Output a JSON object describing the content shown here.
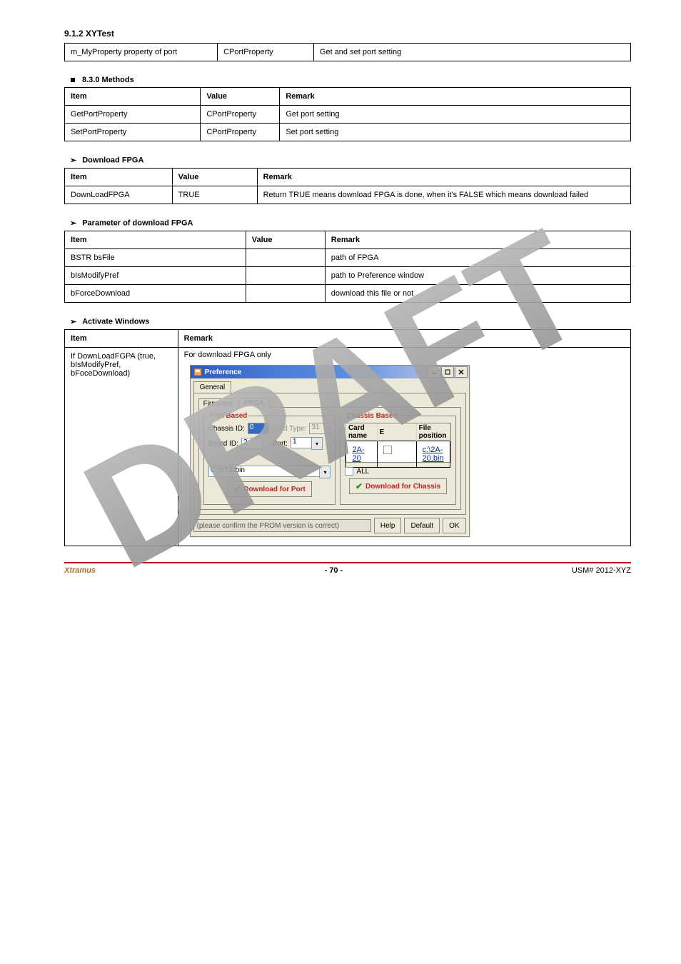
{
  "header1": {
    "title": "9.1.2  XYTest",
    "rows": [
      {
        "item": "m_MyProperty property of port",
        "value": "CPortProperty",
        "remark": "Get and set port setting"
      }
    ]
  },
  "sec830": {
    "title": "8.3.0  Methods",
    "rows": [
      {
        "item": "Item",
        "value": "Value",
        "remark": "Remark"
      },
      {
        "item": "GetPortProperty",
        "value": "CPortProperty",
        "remark": "Get port setting"
      },
      {
        "item": "SetPortProperty",
        "value": "CPortProperty",
        "remark": "Set port setting"
      }
    ]
  },
  "download": {
    "title": "Download FPGA",
    "rows": [
      {
        "item": "Item",
        "value": "Value",
        "remark": "Remark"
      },
      {
        "item": "DownLoadFPGA",
        "value": "TRUE",
        "remark": "Return TRUE means download FPGA is done, when it's FALSE which means download failed"
      }
    ]
  },
  "fpga": {
    "title": "Parameter of download FPGA",
    "rows": [
      {
        "item": "Item",
        "value": "Value",
        "remark": "Remark"
      },
      {
        "item": "BSTR bsFile",
        "value": "",
        "remark": "path of FPGA"
      },
      {
        "item": "bIsModifyPref",
        "value": "",
        "remark": "path to Preference window"
      },
      {
        "item": "bForceDownload",
        "value": "",
        "remark": "download this file or not"
      }
    ]
  },
  "activate": {
    "title": "Activate Windows",
    "rows": [
      {
        "item": "Item",
        "remark": "Remark"
      },
      {
        "item": "If DownLoadFGPA (true, bIsModifyPref, bFoceDownload)",
        "remark": "For download FPGA only"
      }
    ]
  },
  "pref": {
    "title": "Preference",
    "tab_general": "General",
    "tab_firmware": "Firmware",
    "tab_fpga": "FPGA",
    "port_based": "Port Based",
    "chassis_based": "Chassis Based",
    "chassis_id_lbl": "Chassis ID:",
    "chassis_id_val": "0",
    "card_type_lbl": "Card Type:",
    "card_type_val": "31",
    "board_id_lbl": "Board ID:",
    "board_id_val": "2",
    "port_lbl": "Port:",
    "port_val": "1",
    "file_input": "C:\\XYZ.bin",
    "download_port": "Download for Port",
    "download_chassis": "Download for Chassis",
    "list_headers": {
      "card": "Card name",
      "e": "E",
      "file": "File position"
    },
    "list_row": {
      "card": "2A-20",
      "file": "c:\\2A-20.bin"
    },
    "all_lbl": "ALL",
    "status": "(please confirm the PROM version is correct)",
    "help": "Help",
    "default": "Default",
    "ok": "OK"
  },
  "footer": {
    "left": "Xtramus",
    "center": "- 70 -",
    "right": "USM# 2012-XYZ"
  }
}
